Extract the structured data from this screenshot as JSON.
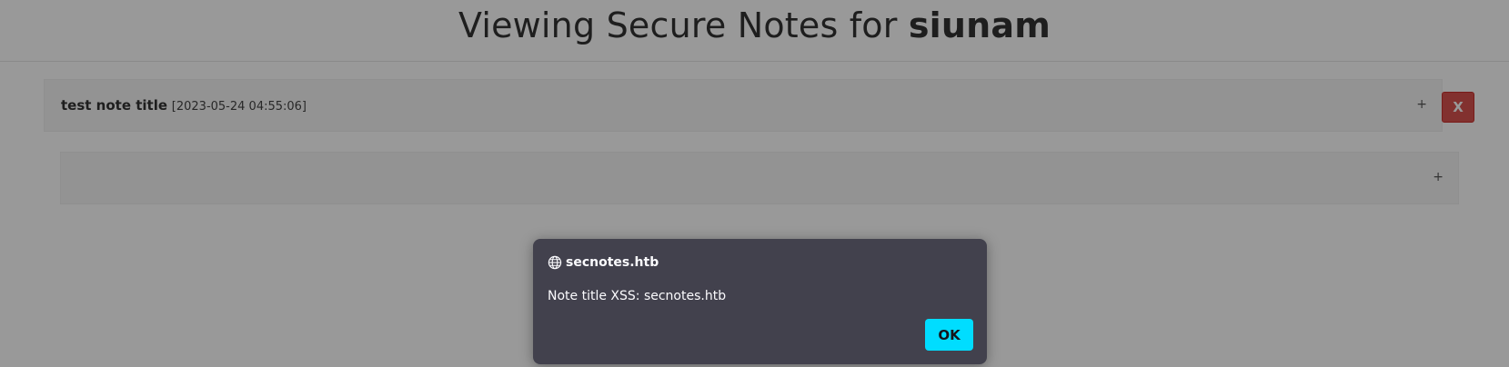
{
  "header": {
    "title_prefix": "Viewing Secure Notes for",
    "username": "siunam"
  },
  "notes": [
    {
      "title": "test note title",
      "date": "[2023-05-24 04:55:06]",
      "toggle": "+",
      "delete_label": "X"
    },
    {
      "title": "",
      "date": "",
      "toggle": "+"
    }
  ],
  "dialog": {
    "origin": "secnotes.htb",
    "origin_icon": "globe-icon",
    "message": "Note title XSS: secnotes.htb",
    "ok_label": "OK"
  },
  "colors": {
    "delete_button": "#d9534f",
    "dialog_background": "#42414d",
    "ok_button": "#00ddff",
    "panel_background": "#f5f5f5"
  }
}
